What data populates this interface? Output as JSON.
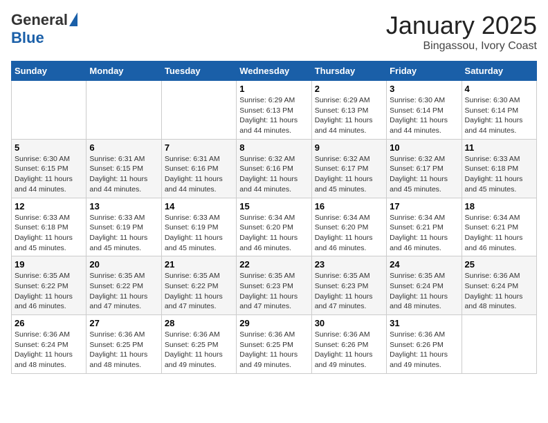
{
  "header": {
    "logo_general": "General",
    "logo_blue": "Blue",
    "month": "January 2025",
    "location": "Bingassou, Ivory Coast"
  },
  "weekdays": [
    "Sunday",
    "Monday",
    "Tuesday",
    "Wednesday",
    "Thursday",
    "Friday",
    "Saturday"
  ],
  "weeks": [
    [
      {
        "day": "",
        "info": ""
      },
      {
        "day": "",
        "info": ""
      },
      {
        "day": "",
        "info": ""
      },
      {
        "day": "1",
        "info": "Sunrise: 6:29 AM\nSunset: 6:13 PM\nDaylight: 11 hours and 44 minutes."
      },
      {
        "day": "2",
        "info": "Sunrise: 6:29 AM\nSunset: 6:13 PM\nDaylight: 11 hours and 44 minutes."
      },
      {
        "day": "3",
        "info": "Sunrise: 6:30 AM\nSunset: 6:14 PM\nDaylight: 11 hours and 44 minutes."
      },
      {
        "day": "4",
        "info": "Sunrise: 6:30 AM\nSunset: 6:14 PM\nDaylight: 11 hours and 44 minutes."
      }
    ],
    [
      {
        "day": "5",
        "info": "Sunrise: 6:30 AM\nSunset: 6:15 PM\nDaylight: 11 hours and 44 minutes."
      },
      {
        "day": "6",
        "info": "Sunrise: 6:31 AM\nSunset: 6:15 PM\nDaylight: 11 hours and 44 minutes."
      },
      {
        "day": "7",
        "info": "Sunrise: 6:31 AM\nSunset: 6:16 PM\nDaylight: 11 hours and 44 minutes."
      },
      {
        "day": "8",
        "info": "Sunrise: 6:32 AM\nSunset: 6:16 PM\nDaylight: 11 hours and 44 minutes."
      },
      {
        "day": "9",
        "info": "Sunrise: 6:32 AM\nSunset: 6:17 PM\nDaylight: 11 hours and 45 minutes."
      },
      {
        "day": "10",
        "info": "Sunrise: 6:32 AM\nSunset: 6:17 PM\nDaylight: 11 hours and 45 minutes."
      },
      {
        "day": "11",
        "info": "Sunrise: 6:33 AM\nSunset: 6:18 PM\nDaylight: 11 hours and 45 minutes."
      }
    ],
    [
      {
        "day": "12",
        "info": "Sunrise: 6:33 AM\nSunset: 6:18 PM\nDaylight: 11 hours and 45 minutes."
      },
      {
        "day": "13",
        "info": "Sunrise: 6:33 AM\nSunset: 6:19 PM\nDaylight: 11 hours and 45 minutes."
      },
      {
        "day": "14",
        "info": "Sunrise: 6:33 AM\nSunset: 6:19 PM\nDaylight: 11 hours and 45 minutes."
      },
      {
        "day": "15",
        "info": "Sunrise: 6:34 AM\nSunset: 6:20 PM\nDaylight: 11 hours and 46 minutes."
      },
      {
        "day": "16",
        "info": "Sunrise: 6:34 AM\nSunset: 6:20 PM\nDaylight: 11 hours and 46 minutes."
      },
      {
        "day": "17",
        "info": "Sunrise: 6:34 AM\nSunset: 6:21 PM\nDaylight: 11 hours and 46 minutes."
      },
      {
        "day": "18",
        "info": "Sunrise: 6:34 AM\nSunset: 6:21 PM\nDaylight: 11 hours and 46 minutes."
      }
    ],
    [
      {
        "day": "19",
        "info": "Sunrise: 6:35 AM\nSunset: 6:22 PM\nDaylight: 11 hours and 46 minutes."
      },
      {
        "day": "20",
        "info": "Sunrise: 6:35 AM\nSunset: 6:22 PM\nDaylight: 11 hours and 47 minutes."
      },
      {
        "day": "21",
        "info": "Sunrise: 6:35 AM\nSunset: 6:22 PM\nDaylight: 11 hours and 47 minutes."
      },
      {
        "day": "22",
        "info": "Sunrise: 6:35 AM\nSunset: 6:23 PM\nDaylight: 11 hours and 47 minutes."
      },
      {
        "day": "23",
        "info": "Sunrise: 6:35 AM\nSunset: 6:23 PM\nDaylight: 11 hours and 47 minutes."
      },
      {
        "day": "24",
        "info": "Sunrise: 6:35 AM\nSunset: 6:24 PM\nDaylight: 11 hours and 48 minutes."
      },
      {
        "day": "25",
        "info": "Sunrise: 6:36 AM\nSunset: 6:24 PM\nDaylight: 11 hours and 48 minutes."
      }
    ],
    [
      {
        "day": "26",
        "info": "Sunrise: 6:36 AM\nSunset: 6:24 PM\nDaylight: 11 hours and 48 minutes."
      },
      {
        "day": "27",
        "info": "Sunrise: 6:36 AM\nSunset: 6:25 PM\nDaylight: 11 hours and 48 minutes."
      },
      {
        "day": "28",
        "info": "Sunrise: 6:36 AM\nSunset: 6:25 PM\nDaylight: 11 hours and 49 minutes."
      },
      {
        "day": "29",
        "info": "Sunrise: 6:36 AM\nSunset: 6:25 PM\nDaylight: 11 hours and 49 minutes."
      },
      {
        "day": "30",
        "info": "Sunrise: 6:36 AM\nSunset: 6:26 PM\nDaylight: 11 hours and 49 minutes."
      },
      {
        "day": "31",
        "info": "Sunrise: 6:36 AM\nSunset: 6:26 PM\nDaylight: 11 hours and 49 minutes."
      },
      {
        "day": "",
        "info": ""
      }
    ]
  ]
}
